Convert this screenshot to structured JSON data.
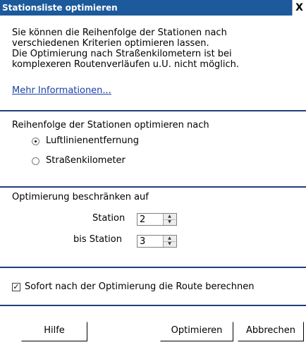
{
  "window": {
    "title": "Stationsliste optimieren",
    "close_glyph": "X"
  },
  "intro": {
    "lines": [
      "Sie können die Reihenfolge der Stationen nach",
      "verschiedenen Kriterien optimieren lassen.",
      "Die Optimierung nach Straßenkilometern ist bei",
      "komplexeren Routenverläufen u.U. nicht möglich."
    ],
    "more_info_link": "Mehr Informationen..."
  },
  "order": {
    "heading": "Reihenfolge der Stationen optimieren nach",
    "options": [
      {
        "label": "Luftlinienentfernung",
        "selected": true
      },
      {
        "label": "Straßenkilometer",
        "selected": false
      }
    ]
  },
  "limit": {
    "heading": "Optimierung beschränken auf",
    "from_label": "Station",
    "from_value": "2",
    "to_label": "bis Station",
    "to_value": "3"
  },
  "options": {
    "route_checkbox_label": "Sofort nach der Optimierung die Route berechnen",
    "route_checkbox_checked": true
  },
  "buttons": {
    "help": "Hilfe",
    "optimize": "Optimieren",
    "cancel": "Abbrechen"
  },
  "colors": {
    "titlebar": "#1c5a9c",
    "divider": "#1f3f7a",
    "link": "#1a3fa8"
  }
}
